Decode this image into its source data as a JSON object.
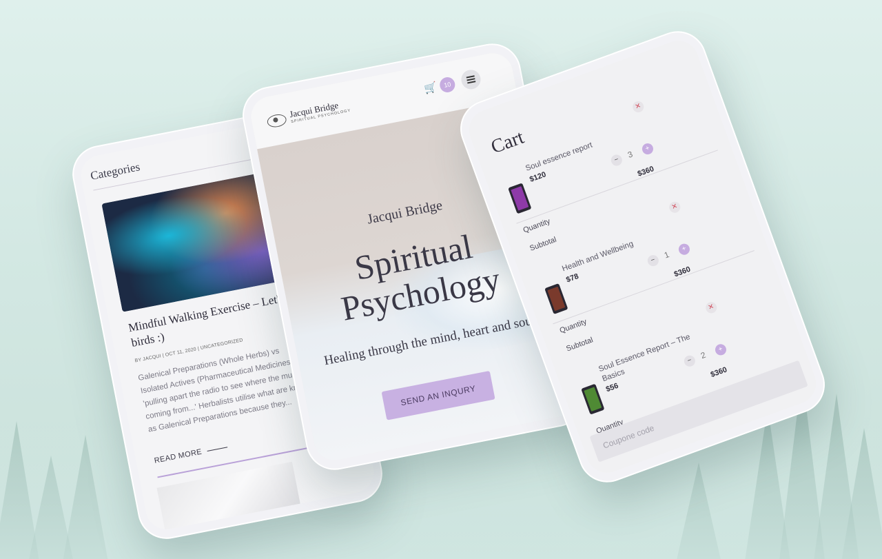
{
  "left_phone": {
    "categories_label": "Categories",
    "post_title": "Mindful Walking Exercise – Let's be birds :)",
    "post_meta": "BY JACQUI | OCT 11, 2020 | UNCATEGORIZED",
    "excerpt": "Galenical Preparations (Whole Herbs) vs Isolated Actives (Pharmaceutical Medicines) 'pulling apart the radio to see where the music is coming from...' Herbalists utilise what are known as Galenical Preparations because they...",
    "read_more": "READ MORE"
  },
  "center_phone": {
    "logo_name": "Jacqui Bridge",
    "logo_sub": "SPIRITUAL PSYCHOLOGY",
    "cart_count": "10",
    "hero_name": "Jacqui Bridge",
    "hero_title_line1": "Spiritual",
    "hero_title_line2": "Psychology",
    "hero_subtitle": "Healing through the mind, heart and soul",
    "cta_label": "SEND AN INQURY"
  },
  "right_phone": {
    "title": "Cart",
    "quantity_label": "Quantity",
    "subtotal_label": "Subtotal",
    "coupon_placeholder": "Coupone code",
    "items": [
      {
        "name": "Soul essence report",
        "price": "$120",
        "qty": "3",
        "total": "$360",
        "cover": "#8e3aa8"
      },
      {
        "name": "Health and Wellbeing",
        "price": "$78",
        "qty": "1",
        "total": "$360",
        "cover": "#7a3a2c"
      },
      {
        "name": "Soul Essence Report – The Basics",
        "price": "$56",
        "qty": "2",
        "total": "$360",
        "cover": "#4f8a34"
      }
    ]
  }
}
